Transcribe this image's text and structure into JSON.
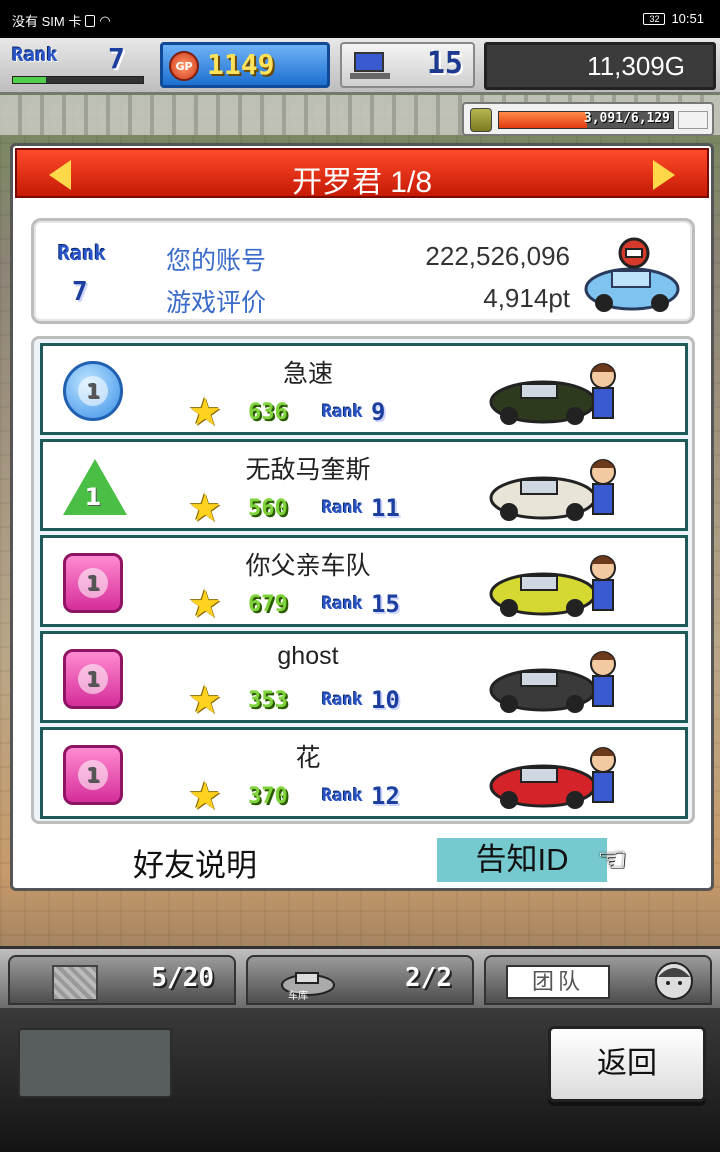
{
  "status_bar": {
    "carrier": "没有 SIM 卡",
    "battery": "32",
    "time": "10:51"
  },
  "hud": {
    "rank_word": "Rank",
    "rank": "7",
    "rank_progress": 0.25,
    "gp_icon_label": "GP",
    "gp": "1149",
    "computers": "15",
    "money": "11,309G",
    "fuel_text": "3,091/6,129",
    "fuel_fraction": 0.504
  },
  "panel": {
    "title": "开罗君 1/8",
    "account": {
      "rank_word": "Rank",
      "rank": "7",
      "label_id": "您的账号",
      "id_value": "222,526,096",
      "label_rating": "游戏评价",
      "rating_value": "4,914pt"
    },
    "friends": [
      {
        "badge": "circle",
        "badge_color": "#3a8ee8",
        "badge_num": "1",
        "name": "急速",
        "points": "636",
        "rank_word": "Rank",
        "rank": "9",
        "car_color": "#2e3a1e"
      },
      {
        "badge": "triangle",
        "badge_color": "#4bbf45",
        "badge_num": "1",
        "name": "无敌马奎斯",
        "points": "560",
        "rank_word": "Rank",
        "rank": "11",
        "car_color": "#e8e4d8"
      },
      {
        "badge": "square",
        "badge_color": "#d52e9a",
        "badge_num": "1",
        "name": "你父亲车队",
        "points": "679",
        "rank_word": "Rank",
        "rank": "15",
        "car_color": "#d6d832"
      },
      {
        "badge": "square",
        "badge_color": "#d52e9a",
        "badge_num": "1",
        "name": "ghost",
        "points": "353",
        "rank_word": "Rank",
        "rank": "10",
        "car_color": "#3a3a3a"
      },
      {
        "badge": "square",
        "badge_color": "#d52e9a",
        "badge_num": "1",
        "name": "花",
        "points": "370",
        "rank_word": "Rank",
        "rank": "12",
        "car_color": "#d4242a"
      }
    ],
    "friend_help": "好友说明",
    "notify_id": "告知ID"
  },
  "tabs": {
    "storage": "5/20",
    "garage_label": "车库",
    "garage": "2/2",
    "team_label": "团队"
  },
  "back_label": "返回"
}
